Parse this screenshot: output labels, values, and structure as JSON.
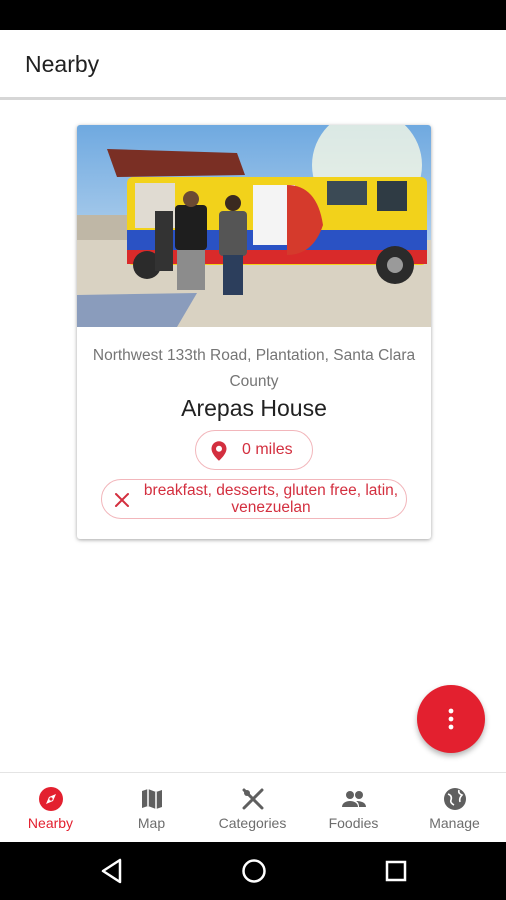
{
  "app_bar": {
    "title": "Nearby"
  },
  "card": {
    "image_alt": "Colorful food truck with customers",
    "address": "Northwest 133th Road, Plantation, Santa Clara County",
    "name": "Arepas House",
    "distance": "0 miles",
    "categories": "breakfast, desserts, gluten free, latin, venezuelan"
  },
  "fab": {
    "icon": "more-vert-icon"
  },
  "bottom_nav": {
    "items": [
      {
        "label": "Nearby",
        "icon": "compass-icon",
        "active": true
      },
      {
        "label": "Map",
        "icon": "map-icon",
        "active": false
      },
      {
        "label": "Categories",
        "icon": "utensils-icon",
        "active": false
      },
      {
        "label": "Foodies",
        "icon": "people-icon",
        "active": false
      },
      {
        "label": "Manage",
        "icon": "globe-icon",
        "active": false
      }
    ]
  },
  "colors": {
    "accent": "#e3202f",
    "chip_border": "#f2b6bb",
    "inactive": "#6d6d6d"
  }
}
